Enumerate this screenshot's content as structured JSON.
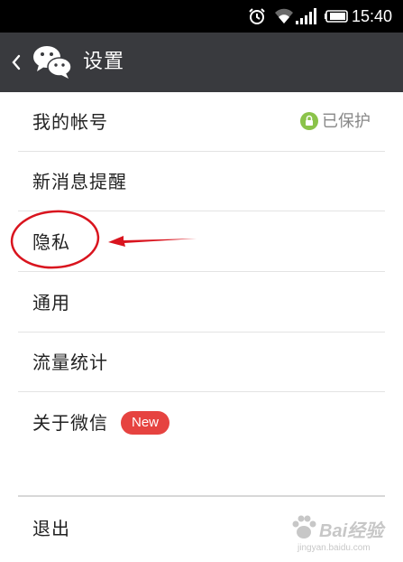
{
  "status_bar": {
    "time": "15:40",
    "icons": [
      "alarm-icon",
      "wifi-icon",
      "signal-icon",
      "battery-icon"
    ]
  },
  "title_bar": {
    "title": "设置",
    "back_icon": "chevron-left-icon",
    "logo_icon": "wechat-logo-icon",
    "background": "#393a3e"
  },
  "settings": {
    "account": {
      "label": "我的帐号",
      "status": "已保护",
      "status_icon": "lock-icon",
      "status_color": "#8bc34a"
    },
    "notifications": {
      "label": "新消息提醒"
    },
    "privacy": {
      "label": "隐私"
    },
    "general": {
      "label": "通用"
    },
    "data_usage": {
      "label": "流量统计"
    },
    "about": {
      "label": "关于微信",
      "badge": "New",
      "badge_color": "#e64340"
    },
    "logout": {
      "label": "退出"
    }
  },
  "annotation": {
    "highlight_color": "#d9141e",
    "shapes": [
      "ellipse-highlight",
      "arrow-pointer"
    ]
  },
  "watermark": {
    "text": "Bai经验",
    "sub": "jingyan.baidu.com"
  }
}
